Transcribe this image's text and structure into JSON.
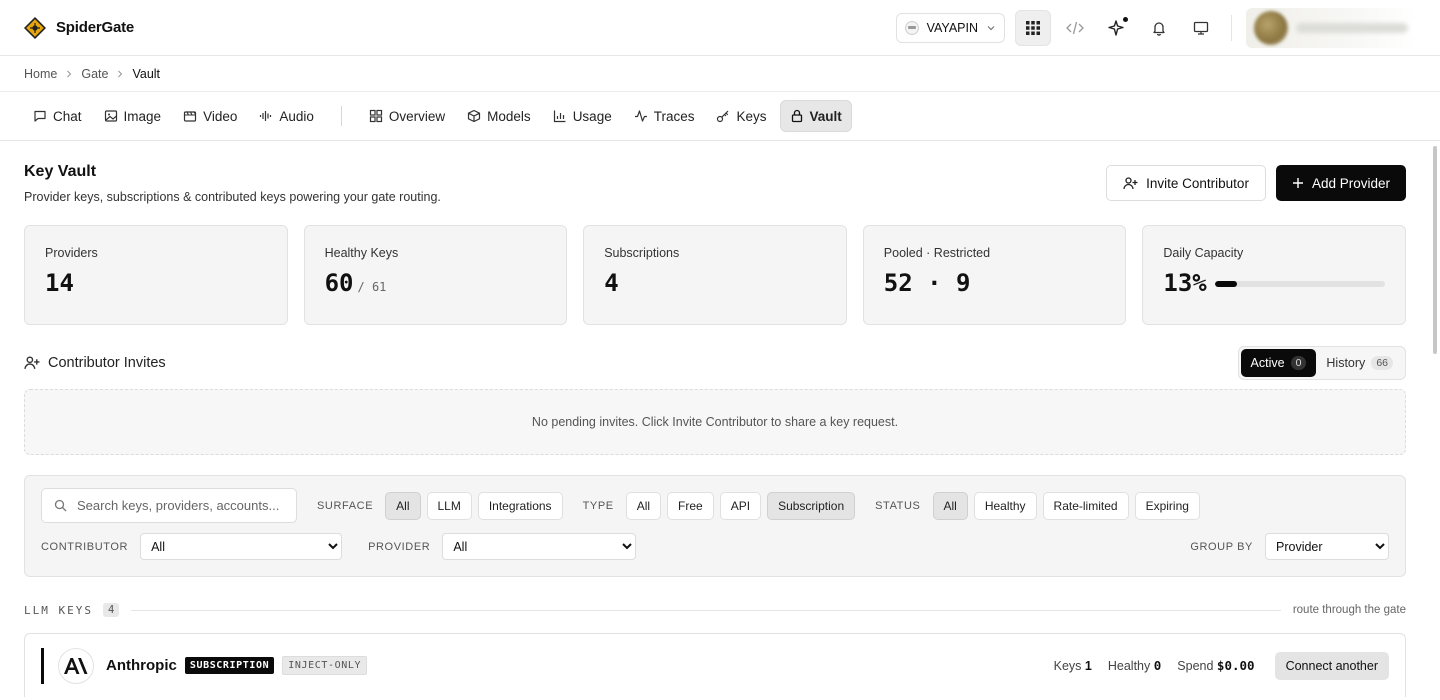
{
  "app": {
    "name": "SpiderGate",
    "org": "VAYAPIN"
  },
  "breadcrumb": [
    "Home",
    "Gate",
    "Vault"
  ],
  "nav": {
    "media": [
      "Chat",
      "Image",
      "Video",
      "Audio"
    ],
    "gate": [
      "Overview",
      "Models",
      "Usage",
      "Traces",
      "Keys",
      "Vault"
    ],
    "active": "Vault"
  },
  "page": {
    "title": "Key Vault",
    "subtitle": "Provider keys, subscriptions & contributed keys powering your gate routing.",
    "invite_label": "Invite Contributor",
    "add_label": "Add Provider"
  },
  "stats": {
    "providers": {
      "label": "Providers",
      "value": "14"
    },
    "healthy": {
      "label": "Healthy Keys",
      "value": "60",
      "total": "/ 61"
    },
    "subscriptions": {
      "label": "Subscriptions",
      "value": "4"
    },
    "pooled": {
      "label": "Pooled · Restricted",
      "value": "52 · 9"
    },
    "capacity": {
      "label": "Daily Capacity",
      "value": "13%",
      "fraction": 0.13
    }
  },
  "invites": {
    "title": "Contributor Invites",
    "tabs": [
      {
        "label": "Active",
        "count": "0"
      },
      {
        "label": "History",
        "count": "66"
      }
    ],
    "empty": "No pending invites. Click Invite Contributor to share a key request."
  },
  "filters": {
    "search_placeholder": "Search keys, providers, accounts...",
    "surface": {
      "label": "SURFACE",
      "options": [
        "All",
        "LLM",
        "Integrations"
      ],
      "selected": "All"
    },
    "type": {
      "label": "TYPE",
      "options": [
        "All",
        "Free",
        "API",
        "Subscription"
      ],
      "selected": "Subscription"
    },
    "status": {
      "label": "STATUS",
      "options": [
        "All",
        "Healthy",
        "Rate-limited",
        "Expiring"
      ],
      "selected": "All"
    },
    "contributor": {
      "label": "CONTRIBUTOR",
      "value": "All"
    },
    "provider": {
      "label": "PROVIDER",
      "value": "All"
    },
    "group_by": {
      "label": "GROUP BY",
      "value": "Provider"
    }
  },
  "group": {
    "title": "LLM KEYS",
    "count": "4",
    "hint": "route through the gate",
    "row": {
      "logo": "AI",
      "name": "Anthropic",
      "badge_primary": "SUBSCRIPTION",
      "badge_secondary": "INJECT-ONLY",
      "keys_label": "Keys",
      "keys": "1",
      "healthy_label": "Healthy",
      "healthy": "0",
      "spend_label": "Spend",
      "spend": "$0.00",
      "action": "Connect another"
    }
  }
}
